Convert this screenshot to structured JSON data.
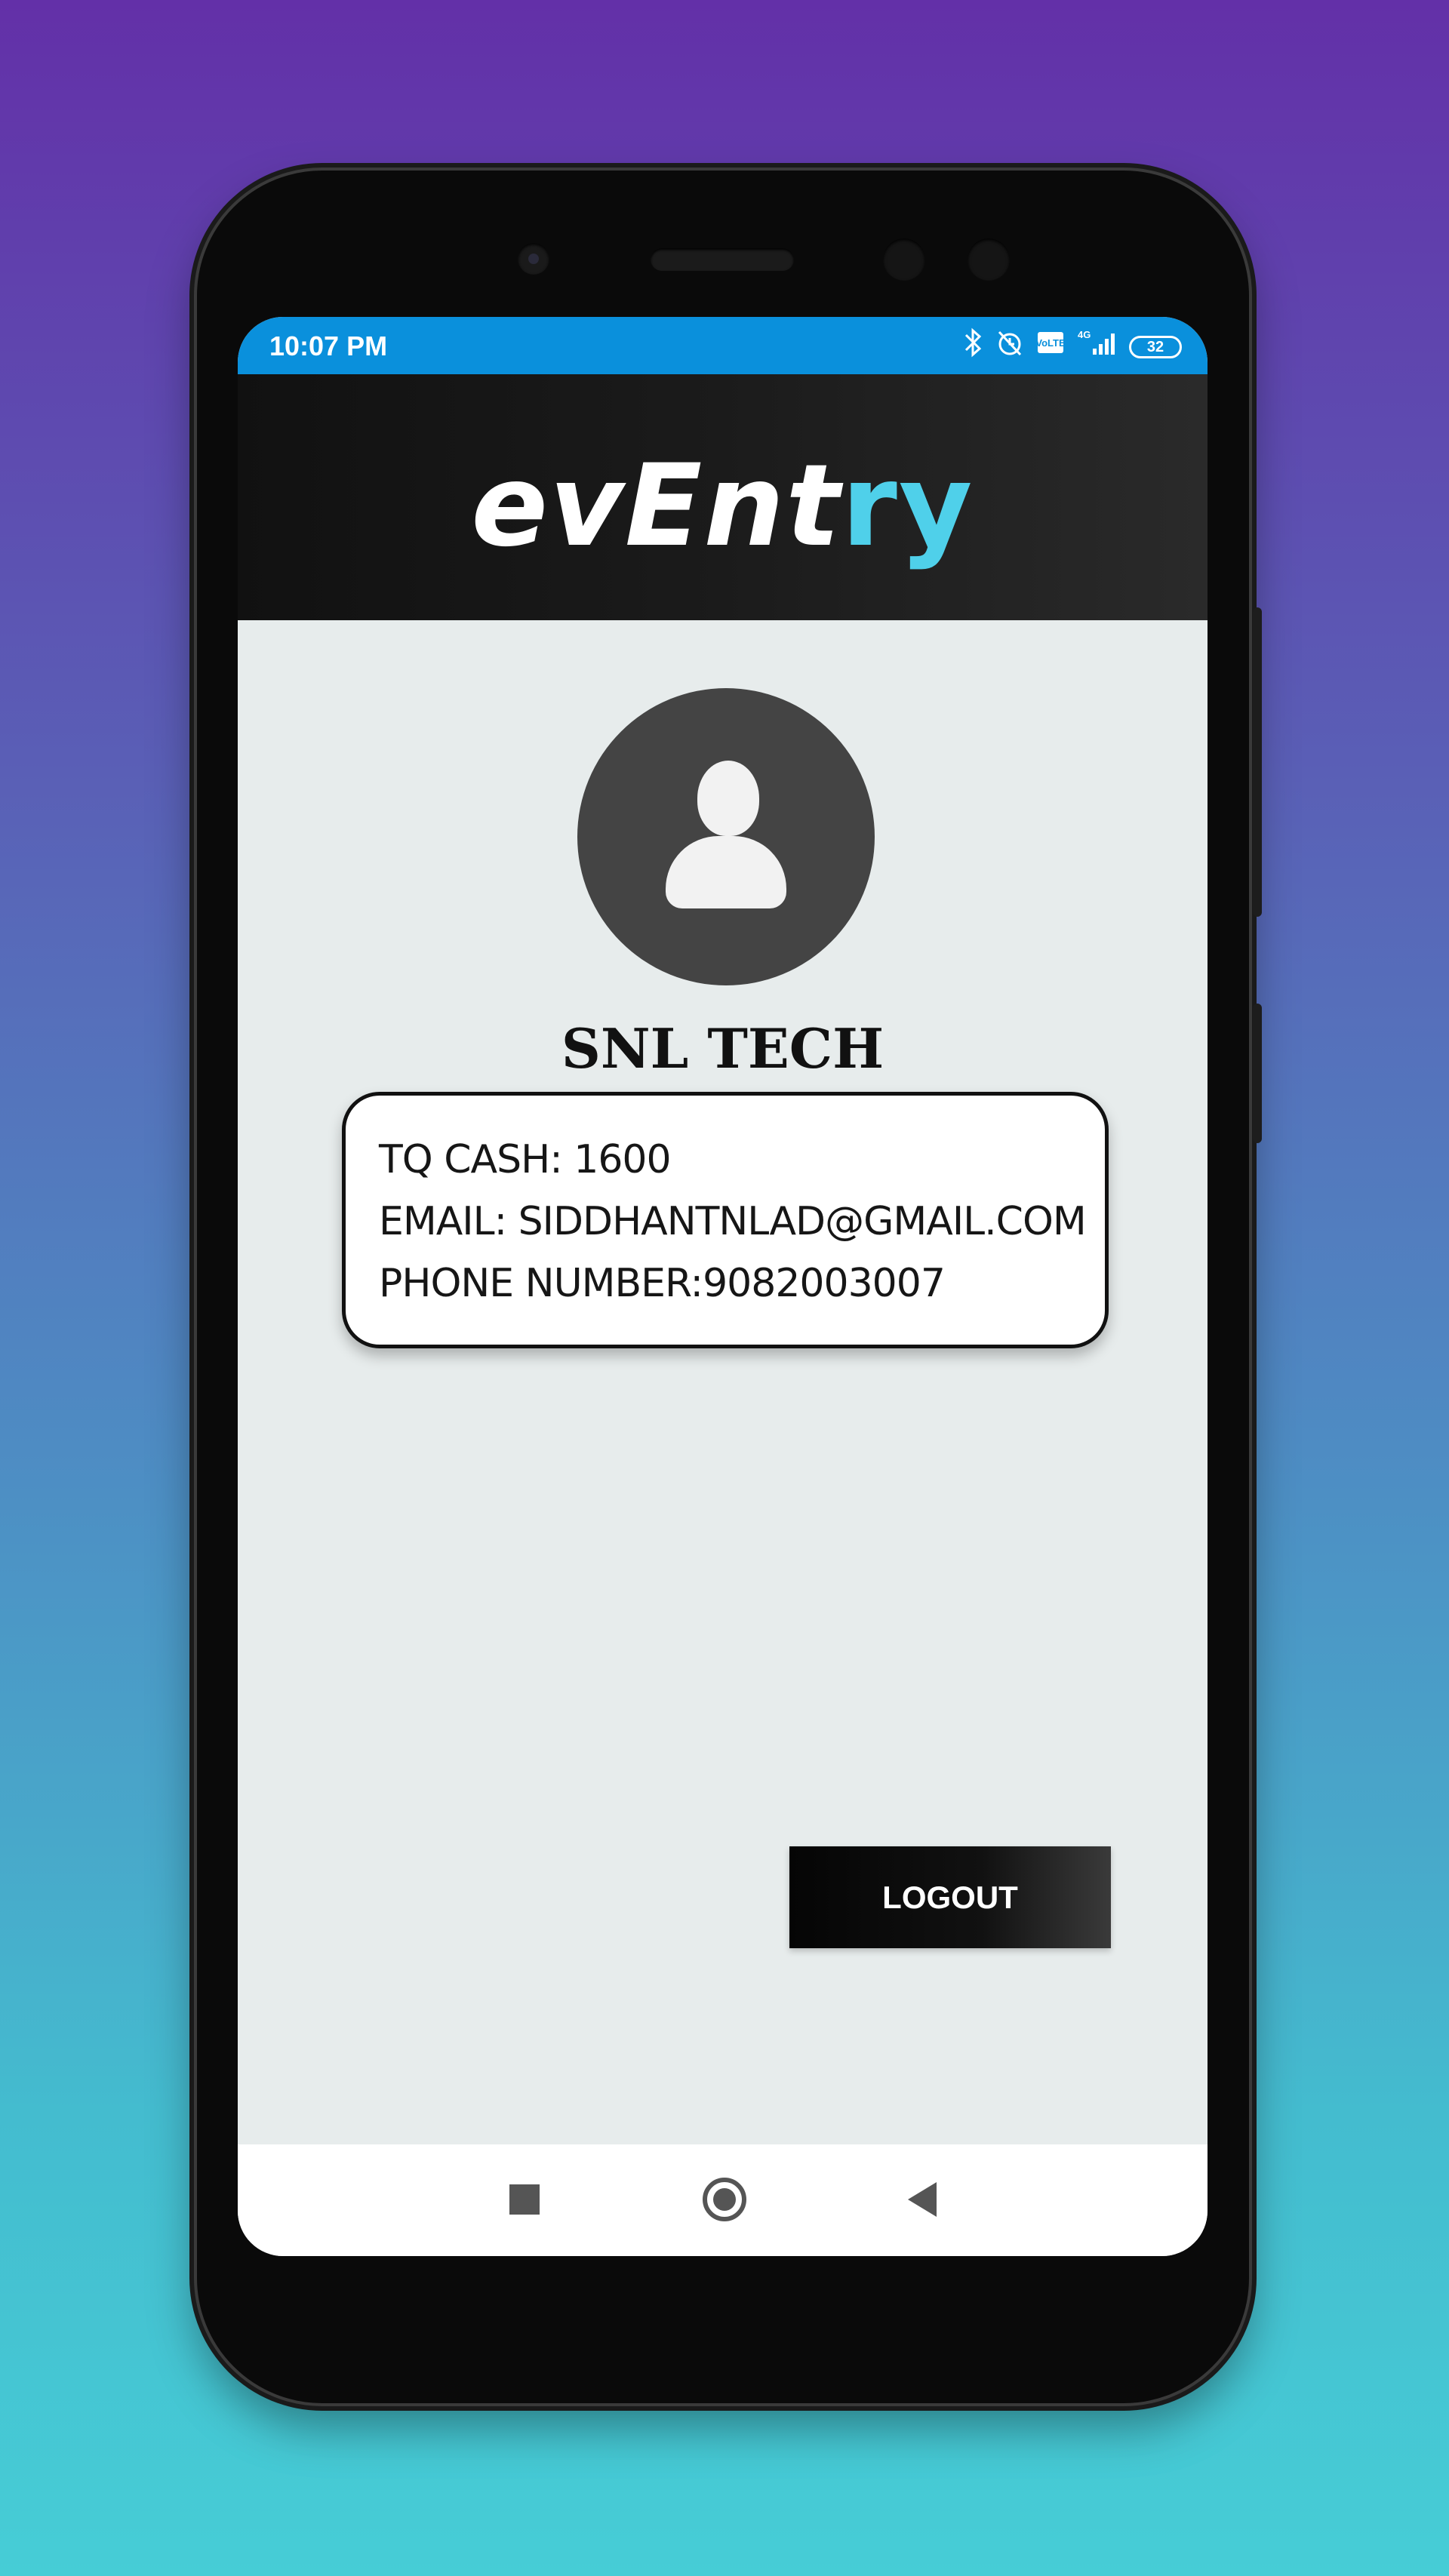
{
  "statusbar": {
    "time": "10:07 PM",
    "icons": [
      "bluetooth-icon",
      "alarm-off-icon",
      "volte-icon",
      "signal-icon"
    ],
    "battery": "32"
  },
  "header": {
    "logo_part1": "evEnt",
    "logo_part2": "ry",
    "colors": {
      "logo_white": "#ffffff",
      "logo_accent": "#4fd0ea"
    }
  },
  "profile": {
    "avatar_icon": "user-icon",
    "name": "SNL TECH",
    "info": {
      "tq_cash": "TQ CASH: 1600",
      "email": "EMAIL: SIDDHANTNLAD@GMAIL.COM",
      "phone": "PHONE NUMBER:9082003007"
    },
    "logout_label": "LOGOUT"
  },
  "navbar": {
    "icons": [
      "recents-square-icon",
      "home-circle-icon",
      "back-triangle-icon"
    ]
  },
  "colors": {
    "statusbar": "#0a90dc",
    "background": "#e7ecec",
    "header": "#111111"
  }
}
